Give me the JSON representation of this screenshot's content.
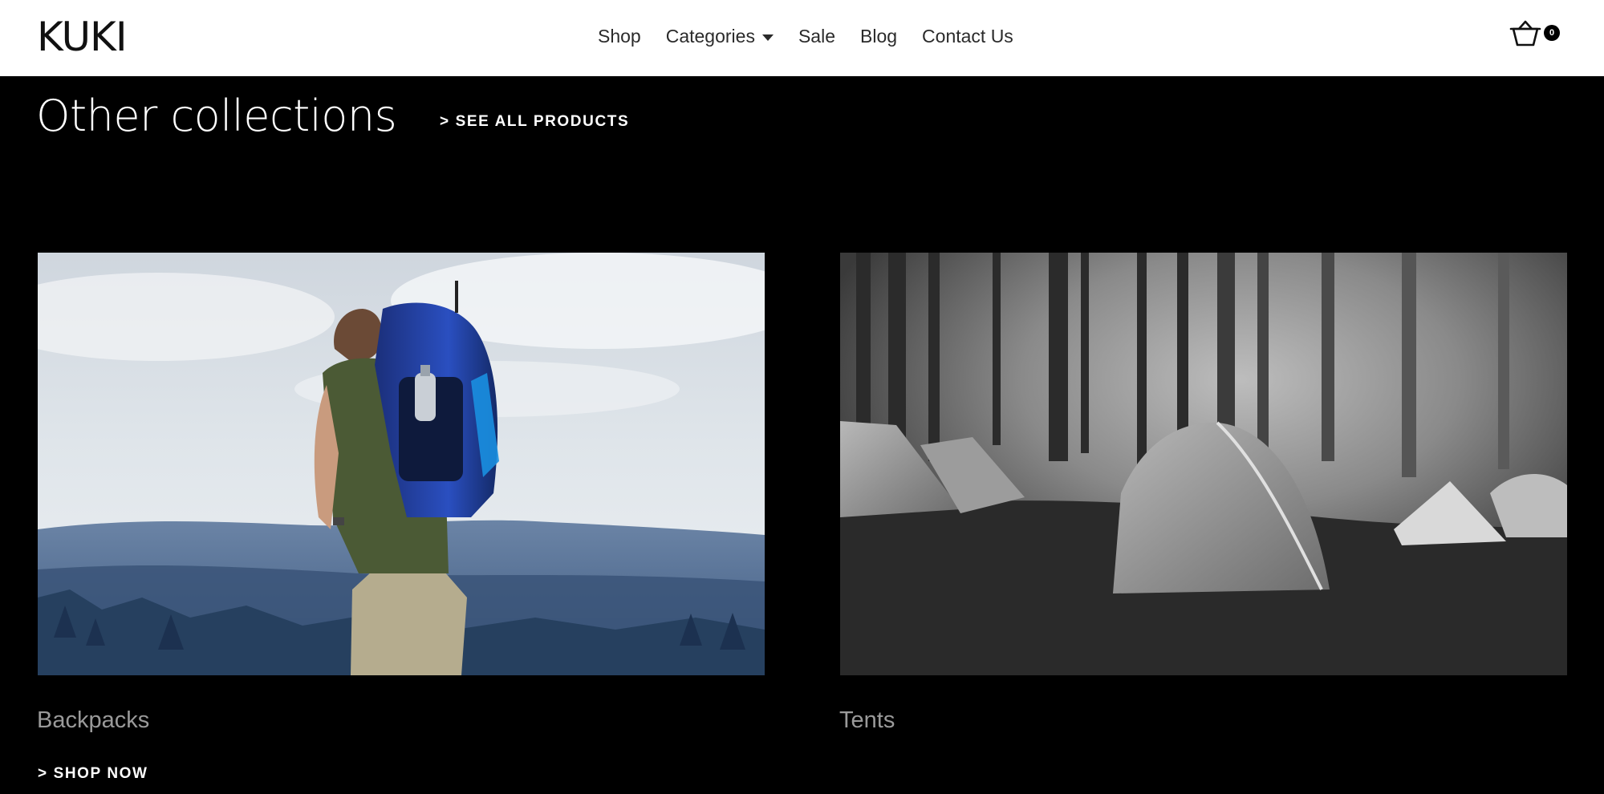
{
  "header": {
    "logo": "KUKI",
    "nav": {
      "shop": "Shop",
      "categories": "Categories",
      "sale": "Sale",
      "blog": "Blog",
      "contact": "Contact Us"
    },
    "cart_count": "0"
  },
  "main": {
    "title": "Other collections",
    "see_all": "> SEE ALL PRODUCTS",
    "cards": [
      {
        "title": "Backpacks",
        "cta": "> SHOP NOW",
        "image": "hiker-with-backpack-photo"
      },
      {
        "title": "Tents",
        "image": "tents-in-foggy-forest-photo"
      }
    ]
  },
  "colors": {
    "page_background": "#000000",
    "header_background": "#ffffff",
    "muted_text": "#9a9a9a"
  }
}
